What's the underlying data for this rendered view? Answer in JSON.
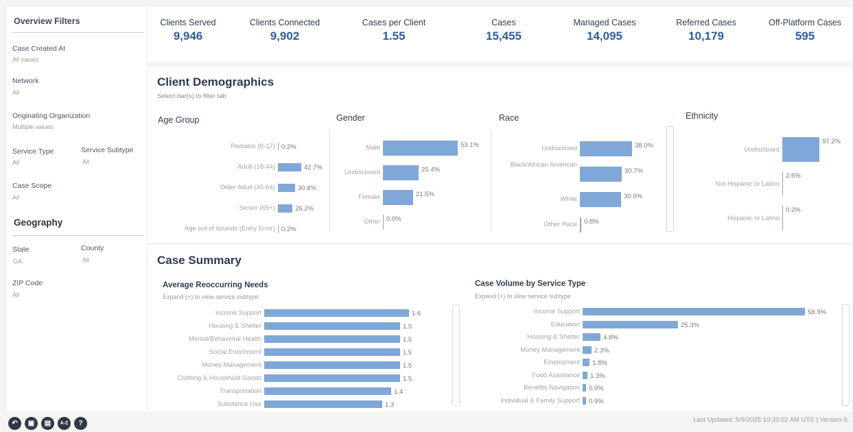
{
  "sidebar": {
    "title": "Overview Filters",
    "filters": [
      {
        "label": "Case Created At",
        "value": "All values"
      },
      {
        "label": "Network",
        "value": "All"
      },
      {
        "label": "Originating Organization",
        "value": "Multiple values"
      },
      {
        "label": "Service Type",
        "value": "All"
      },
      {
        "label": "Service Subtype",
        "value": "All"
      },
      {
        "label": "Case Scope",
        "value": "All"
      }
    ],
    "geography": {
      "title": "Geography",
      "filters": [
        {
          "label": "State",
          "value": "GA"
        },
        {
          "label": "County",
          "value": "All"
        },
        {
          "label": "ZIP Code",
          "value": "All"
        }
      ]
    }
  },
  "kpis": [
    {
      "label": "Clients Served",
      "value": "9,946"
    },
    {
      "label": "Clients Connected",
      "value": "9,902"
    },
    {
      "label": "Cases per Client",
      "value": "1.55"
    },
    {
      "label": "Cases",
      "value": "15,455"
    },
    {
      "label": "Managed Cases",
      "value": "14,095"
    },
    {
      "label": "Referred Cases",
      "value": "10,179"
    },
    {
      "label": "Off-Platform Cases",
      "value": "595"
    }
  ],
  "demographics": {
    "title": "Client Demographics",
    "subtitle": "Select bar(s) to filter tab",
    "age": {
      "title": "Age Group",
      "items": [
        {
          "label": "Pediatric (0-17)",
          "display": "0.2%",
          "pct": 0.2
        },
        {
          "label": "Adult (18-44)",
          "display": "42.7%",
          "pct": 42.7
        },
        {
          "label": "Older Adult (45-64)",
          "display": "30.8%",
          "pct": 30.8
        },
        {
          "label": "Senior (65+)",
          "display": "26.2%",
          "pct": 26.2
        },
        {
          "label": "Age out of bounds (Entry Error)",
          "display": "0.2%",
          "pct": 0.2
        }
      ]
    },
    "gender": {
      "title": "Gender",
      "items": [
        {
          "label": "Male",
          "display": "53.1%",
          "pct": 53.1
        },
        {
          "label": "Undisclosed",
          "display": "25.4%",
          "pct": 25.4
        },
        {
          "label": "Female",
          "display": "21.5%",
          "pct": 21.5
        },
        {
          "label": "Other",
          "display": "0.0%",
          "pct": 0.0
        }
      ]
    },
    "race": {
      "title": "Race",
      "items": [
        {
          "label": "Undisclosed",
          "display": "38.0%",
          "pct": 38.0
        },
        {
          "label": "Black/African American",
          "display": "30.7%",
          "pct": 30.7
        },
        {
          "label": "White",
          "display": "30.0%",
          "pct": 30.0
        },
        {
          "label": "Other Race",
          "display": "0.8%",
          "pct": 0.8
        }
      ]
    },
    "ethnicity": {
      "title": "Ethnicity",
      "items": [
        {
          "label": "Undisclosed",
          "display": "97.2%",
          "pct": 97.2
        },
        {
          "label": "Not Hispanic or Latino",
          "display": "2.6%",
          "pct": 2.6
        },
        {
          "label": "Hispanic or Latino",
          "display": "0.2%",
          "pct": 0.2
        }
      ]
    }
  },
  "case_summary": {
    "title": "Case Summary",
    "needs": {
      "title": "Average Reoccurring Needs",
      "subtitle": "Expand (+) to view service subtype",
      "items": [
        {
          "label": "Income Support",
          "display": "1.6",
          "value": 1.6
        },
        {
          "label": "Housing & Shelter",
          "display": "1.5",
          "value": 1.5
        },
        {
          "label": "Mental/Behavioral Health",
          "display": "1.5",
          "value": 1.5
        },
        {
          "label": "Social Enrichment",
          "display": "1.5",
          "value": 1.5
        },
        {
          "label": "Money Management",
          "display": "1.5",
          "value": 1.5
        },
        {
          "label": "Clothing & Household Goods",
          "display": "1.5",
          "value": 1.5
        },
        {
          "label": "Transportation",
          "display": "1.4",
          "value": 1.4
        },
        {
          "label": "Substance Use",
          "display": "1.3",
          "value": 1.3
        }
      ]
    },
    "volume": {
      "title": "Case Volume by Service Type",
      "subtitle": "Expand (+) to view service subtype",
      "items": [
        {
          "label": "Income Support",
          "display": "58.9%",
          "pct": 58.9
        },
        {
          "label": "Education",
          "display": "25.3%",
          "pct": 25.3
        },
        {
          "label": "Housing & Shelter",
          "display": "4.8%",
          "pct": 4.8
        },
        {
          "label": "Money Management",
          "display": "2.3%",
          "pct": 2.3
        },
        {
          "label": "Employment",
          "display": "1.8%",
          "pct": 1.8
        },
        {
          "label": "Food Assistance",
          "display": "1.3%",
          "pct": 1.3
        },
        {
          "label": "Benefits Navigation",
          "display": "0.9%",
          "pct": 0.9
        },
        {
          "label": "Individual & Family Support",
          "display": "0.9%",
          "pct": 0.9
        }
      ]
    }
  },
  "toolbar": {
    "buttons": [
      {
        "name": "undo-icon",
        "glyph": "↶"
      },
      {
        "name": "save-icon",
        "glyph": "▣"
      },
      {
        "name": "bookmark-icon",
        "glyph": "▤"
      },
      {
        "name": "sort-az-icon",
        "glyph": "A-Z"
      },
      {
        "name": "help-icon",
        "glyph": "?"
      }
    ]
  },
  "footer": "Last Updated: 5/9/2025 10:33:02 AM UTC | Version 3."
}
